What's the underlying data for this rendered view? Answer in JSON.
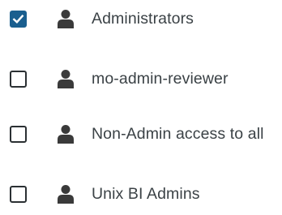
{
  "groups": [
    {
      "label": "Administrators",
      "checked": true
    },
    {
      "label": "mo-admin-reviewer",
      "checked": false
    },
    {
      "label": "Non-Admin access to all",
      "checked": false
    },
    {
      "label": "Unix BI Admins",
      "checked": false
    }
  ],
  "icons": {
    "group_item": "user-icon",
    "check": "checkmark-icon"
  },
  "colors": {
    "checked_fill": "#1a5f8f",
    "text": "#3b4246",
    "box_border": "#2b3033"
  }
}
